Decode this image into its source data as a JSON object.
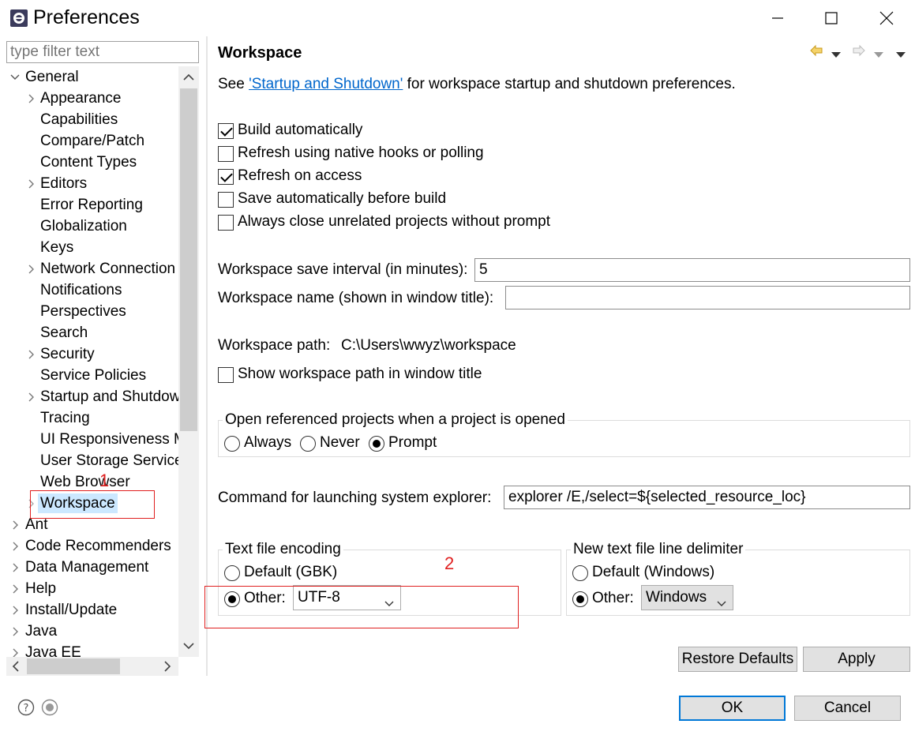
{
  "window": {
    "title": "Preferences"
  },
  "filter": {
    "placeholder": "type filter text"
  },
  "tree": [
    {
      "label": "General",
      "expanded": true
    },
    {
      "label": "Appearance",
      "expandable": true
    },
    {
      "label": "Capabilities"
    },
    {
      "label": "Compare/Patch"
    },
    {
      "label": "Content Types"
    },
    {
      "label": "Editors",
      "expandable": true
    },
    {
      "label": "Error Reporting"
    },
    {
      "label": "Globalization"
    },
    {
      "label": "Keys"
    },
    {
      "label": "Network Connection",
      "expandable": true
    },
    {
      "label": "Notifications"
    },
    {
      "label": "Perspectives"
    },
    {
      "label": "Search"
    },
    {
      "label": "Security",
      "expandable": true
    },
    {
      "label": "Service Policies"
    },
    {
      "label": "Startup and Shutdow",
      "expandable": true
    },
    {
      "label": "Tracing"
    },
    {
      "label": "UI Responsiveness M"
    },
    {
      "label": "User Storage Service"
    },
    {
      "label": "Web Browser"
    },
    {
      "label": "Workspace",
      "expandable": true,
      "selected": true
    },
    {
      "label": "Ant",
      "expandable": true
    },
    {
      "label": "Code Recommenders",
      "expandable": true
    },
    {
      "label": "Data Management",
      "expandable": true
    },
    {
      "label": "Help",
      "expandable": true
    },
    {
      "label": "Install/Update",
      "expandable": true
    },
    {
      "label": "Java",
      "expandable": true
    },
    {
      "label": "Java EE",
      "expandable": true
    }
  ],
  "page": {
    "title": "Workspace",
    "intro_prefix": "See ",
    "intro_link": "'Startup and Shutdown'",
    "intro_suffix": " for workspace startup and shutdown preferences.",
    "checkboxes": [
      {
        "label": "Build automatically",
        "checked": true
      },
      {
        "label": "Refresh using native hooks or polling",
        "checked": false
      },
      {
        "label": "Refresh on access",
        "checked": true
      },
      {
        "label": "Save automatically before build",
        "checked": false
      },
      {
        "label": "Always close unrelated projects without prompt",
        "checked": false
      }
    ],
    "save_interval_label": "Workspace save interval (in minutes):",
    "save_interval_value": "5",
    "workspace_name_label": "Workspace name (shown in window title):",
    "workspace_name_value": "",
    "workspace_path_label": "Workspace path:",
    "workspace_path_value": "C:\\Users\\wwyz\\workspace",
    "show_path_label": "Show workspace path in window title",
    "open_projects_group": {
      "title": "Open referenced projects when a project is opened",
      "options": [
        "Always",
        "Never",
        "Prompt"
      ],
      "selected": "Prompt"
    },
    "explorer_label": "Command for launching system explorer:",
    "explorer_value": "explorer /E,/select=${selected_resource_loc}",
    "encoding_group": {
      "title": "Text file encoding",
      "default_label": "Default (GBK)",
      "other_label": "Other:",
      "other_value": "UTF-8",
      "selected": "Other"
    },
    "delimiter_group": {
      "title": "New text file line delimiter",
      "default_label": "Default (Windows)",
      "other_label": "Other:",
      "other_value": "Windows",
      "selected": "Other"
    },
    "restore_defaults": "Restore Defaults",
    "apply": "Apply"
  },
  "footer": {
    "ok": "OK",
    "cancel": "Cancel"
  },
  "annotations": {
    "first": "1",
    "second": "2",
    "color": "#e02020"
  }
}
